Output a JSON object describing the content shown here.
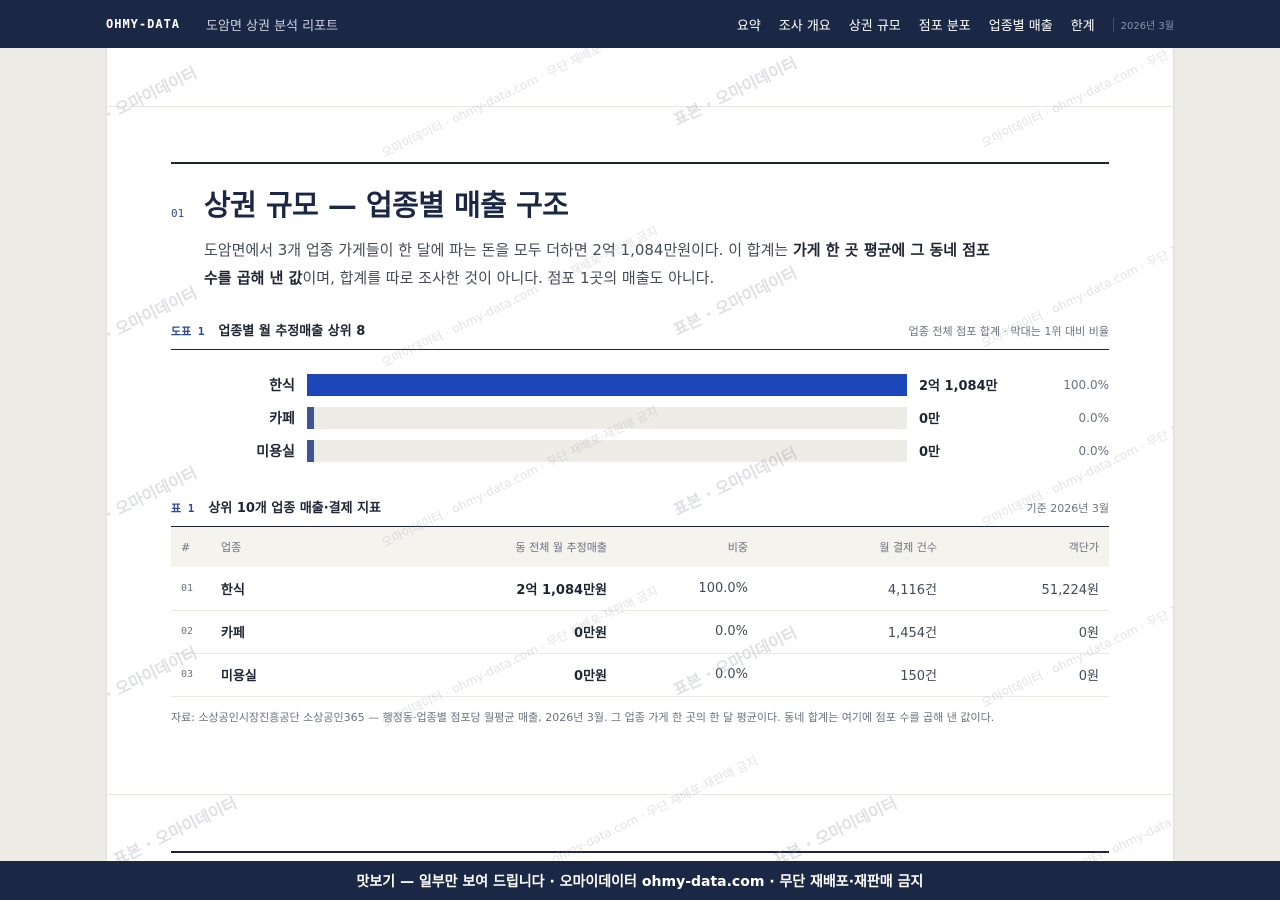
{
  "header": {
    "brand": "OHMY-DATA",
    "report_title": "도암면 상권 분석 리포트",
    "nav": [
      "요약",
      "조사 개요",
      "상권 규모",
      "점포 분포",
      "업종별 매출",
      "한계"
    ],
    "date": "2026년 3월"
  },
  "section": {
    "number": "01",
    "title": "상권 규모 — 업종별 매출 구조",
    "lead_1": "도암면에서 3개 업종 가게들이 한 달에 파는 돈을 모두 더하면 2억 1,084만원이다. 이 합계는 ",
    "lead_bold": "가게 한 곳 평균에 그 동네 점포 수를 곱해 낸 값",
    "lead_2": "이며, 합계를 따로 조사한 것이 아니다. 점포 1곳의 매출도 아니다."
  },
  "figure": {
    "tag": "도표 1",
    "title": "업종별 월 추정매출 상위 8",
    "note": "업종 전체 점포 합계 · 막대는 1위 대비 비율"
  },
  "chart_data": {
    "type": "bar",
    "title": "업종별 월 추정매출 상위 8",
    "categories": [
      "한식",
      "카페",
      "미용실"
    ],
    "values": [
      21084,
      0,
      0
    ],
    "value_labels": [
      "2억 1,084만",
      "0만",
      "0만"
    ],
    "percent_labels": [
      "100.0%",
      "0.0%",
      "0.0%"
    ],
    "bar_color": "#1d46b8"
  },
  "table": {
    "tag": "표 1",
    "title": "상위 10개 업종 매출·결제 지표",
    "note": "기준 2026년 3월",
    "columns": [
      "#",
      "업종",
      "동 전체 월 추정매출",
      "비중",
      "월 결제 건수",
      "객단가"
    ],
    "rows": [
      [
        "01",
        "한식",
        "2억 1,084만원",
        "100.0%",
        "4,116건",
        "51,224원"
      ],
      [
        "02",
        "카페",
        "0만원",
        "0.0%",
        "1,454건",
        "0원"
      ],
      [
        "03",
        "미용실",
        "0만원",
        "0.0%",
        "150건",
        "0원"
      ]
    ],
    "source": "자료: 소상공인시장진흥공단 소상공인365 — 행정동·업종별 점포당 월평균 매출, 2026년 3월. 그 업종 가게 한 곳의 한 달 평균이다. 동네 합계는 여기에 점포 수를 곱해 낸 값이다."
  },
  "watermark": {
    "main": "표본 · 오마이데이터",
    "sub": "오마이데이터 · ohmy-data.com · 무단 재배포·재판매 금지"
  },
  "footer": {
    "text": "맛보기 — 일부만 보여 드립니다 · 오마이데이터 ohmy-data.com · 무단 재배포·재판매 금지"
  }
}
